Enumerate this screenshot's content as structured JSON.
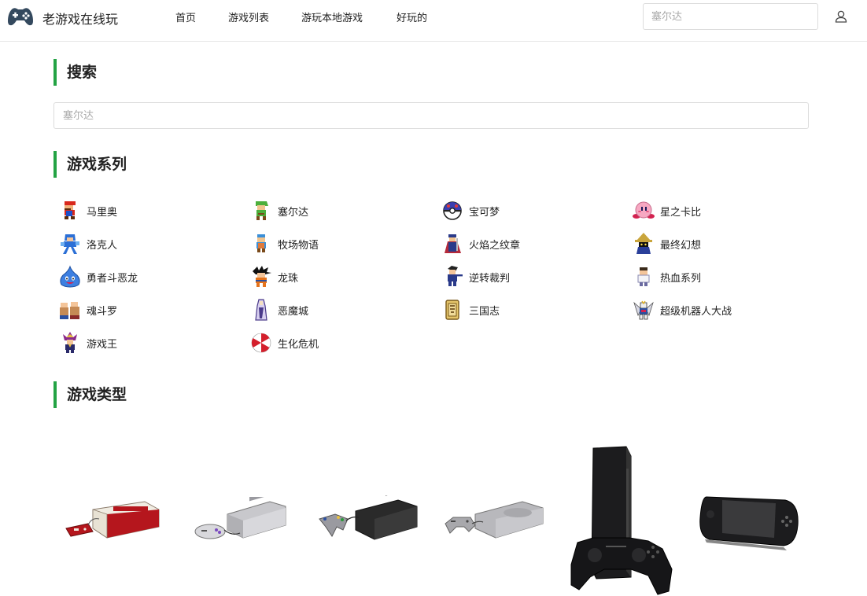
{
  "header": {
    "site_name": "老游戏在线玩",
    "nav": [
      "首页",
      "游戏列表",
      "游玩本地游戏",
      "好玩的"
    ],
    "search_placeholder": "塞尔达"
  },
  "sections": {
    "search_title": "搜索",
    "series_title": "游戏系列",
    "types_title": "游戏类型"
  },
  "main_search": {
    "placeholder": "塞尔达"
  },
  "series": [
    {
      "label": "马里奥",
      "icon": "mario-icon"
    },
    {
      "label": "塞尔达",
      "icon": "link-icon"
    },
    {
      "label": "宝可梦",
      "icon": "pokeball-icon"
    },
    {
      "label": "星之卡比",
      "icon": "kirby-icon"
    },
    {
      "label": "洛克人",
      "icon": "megaman-icon"
    },
    {
      "label": "牧场物语",
      "icon": "farmer-icon"
    },
    {
      "label": "火焰之纹章",
      "icon": "knight-icon"
    },
    {
      "label": "最终幻想",
      "icon": "black-mage-icon"
    },
    {
      "label": "勇者斗恶龙",
      "icon": "slime-icon"
    },
    {
      "label": "龙珠",
      "icon": "goku-icon"
    },
    {
      "label": "逆转裁判",
      "icon": "lawyer-icon"
    },
    {
      "label": "热血系列",
      "icon": "kunio-icon"
    },
    {
      "label": "魂斗罗",
      "icon": "contra-icon"
    },
    {
      "label": "恶魔城",
      "icon": "castlevania-icon"
    },
    {
      "label": "三国志",
      "icon": "scroll-icon"
    },
    {
      "label": "超级机器人大战",
      "icon": "robot-icon"
    },
    {
      "label": "游戏王",
      "icon": "yugi-icon"
    },
    {
      "label": "生化危机",
      "icon": "umbrella-icon"
    }
  ],
  "colors": {
    "accent": "#23a344",
    "border": "#dcdcdc"
  }
}
